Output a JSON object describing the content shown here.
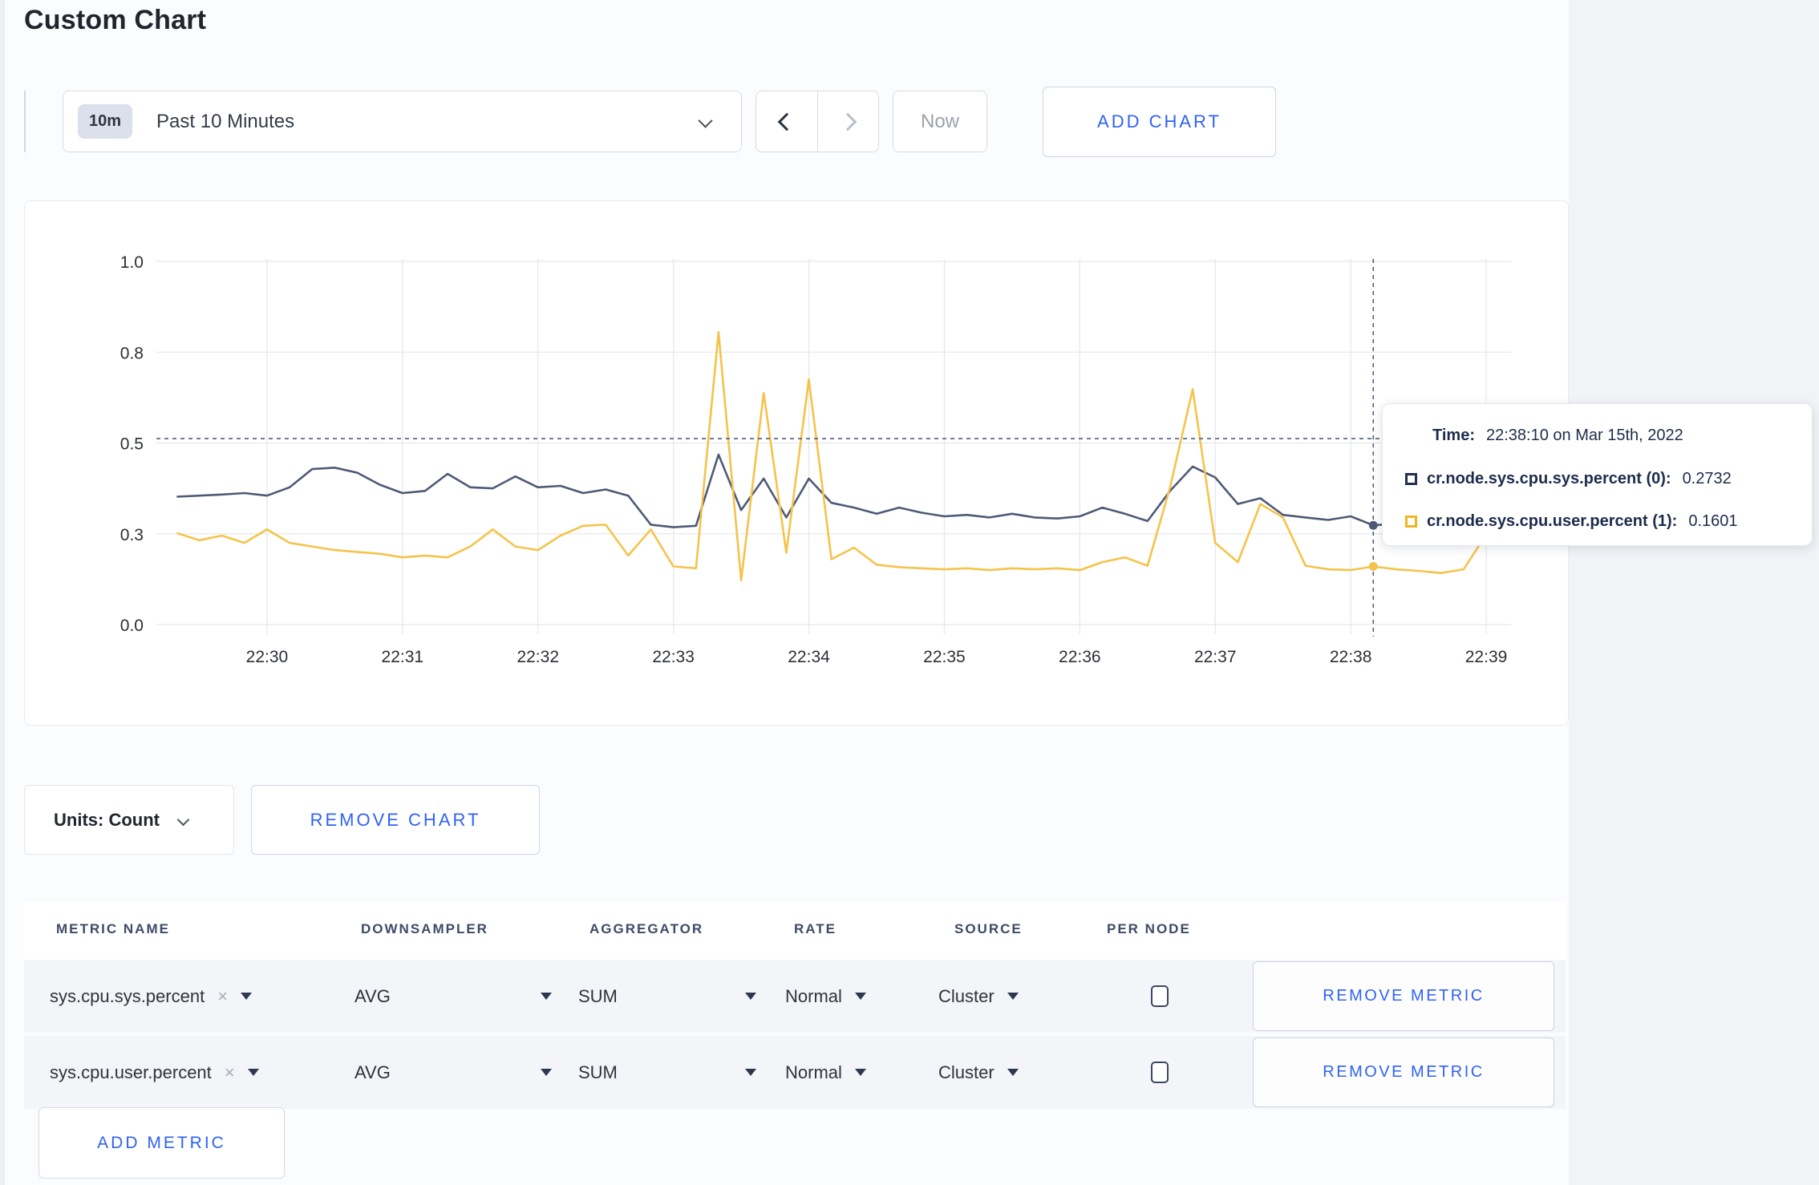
{
  "page": {
    "title": "Custom Chart",
    "background": "#fbfcfd",
    "gutter_color": "#f1f3f7",
    "accent_blue": "#2f62f4"
  },
  "toolbar": {
    "range_badge": "10m",
    "range_label": "Past 10 Minutes",
    "prev_icon": "chevron-left",
    "next_icon": "chevron-right",
    "now_label": "Now",
    "add_chart_label": "ADD CHART"
  },
  "chart_data": {
    "type": "line",
    "title": "",
    "xlabel": "",
    "ylabel": "",
    "ylim": [
      0,
      1
    ],
    "grid": true,
    "legend_position": "none",
    "y_ticks": [
      {
        "label": "1.0",
        "value": 1.0
      },
      {
        "label": "0.8",
        "value": 0.75
      },
      {
        "label": "0.5",
        "value": 0.5
      },
      {
        "label": "0.3",
        "value": 0.25
      },
      {
        "label": "0.0",
        "value": 0.0
      }
    ],
    "x_ticks": [
      "22:30",
      "22:31",
      "22:32",
      "22:33",
      "22:34",
      "22:35",
      "22:36",
      "22:37",
      "22:38",
      "22:39"
    ],
    "x_domain_start": "22:29:11",
    "x_domain_seconds": 600,
    "series_start_time": "22:29:20",
    "series_interval_sec": 10,
    "series": [
      {
        "name": "cr.node.sys.cpu.sys.percent",
        "color": "#4e5b76",
        "values": [
          0.352,
          0.355,
          0.358,
          0.362,
          0.355,
          0.378,
          0.428,
          0.432,
          0.418,
          0.385,
          0.362,
          0.368,
          0.415,
          0.378,
          0.375,
          0.408,
          0.378,
          0.382,
          0.362,
          0.372,
          0.355,
          0.275,
          0.268,
          0.272,
          0.468,
          0.315,
          0.402,
          0.295,
          0.402,
          0.335,
          0.322,
          0.305,
          0.322,
          0.308,
          0.298,
          0.302,
          0.295,
          0.305,
          0.295,
          0.292,
          0.298,
          0.322,
          0.305,
          0.285,
          0.368,
          0.435,
          0.405,
          0.332,
          0.348,
          0.302,
          0.295,
          0.288,
          0.298,
          0.2732,
          0.278,
          0.285,
          0.308,
          0.298,
          0.305,
          0.298
        ]
      },
      {
        "name": "cr.node.sys.cpu.user.percent",
        "color": "#f5c34b",
        "values": [
          0.252,
          0.232,
          0.245,
          0.225,
          0.262,
          0.225,
          0.215,
          0.205,
          0.2,
          0.195,
          0.185,
          0.19,
          0.185,
          0.215,
          0.262,
          0.215,
          0.205,
          0.245,
          0.272,
          0.275,
          0.19,
          0.262,
          0.16,
          0.155,
          0.805,
          0.122,
          0.638,
          0.198,
          0.675,
          0.18,
          0.212,
          0.165,
          0.158,
          0.155,
          0.152,
          0.155,
          0.15,
          0.155,
          0.152,
          0.155,
          0.15,
          0.172,
          0.185,
          0.162,
          0.378,
          0.648,
          0.225,
          0.172,
          0.332,
          0.295,
          0.162,
          0.152,
          0.15,
          0.1601,
          0.152,
          0.148,
          0.142,
          0.152,
          0.248,
          0.222
        ]
      }
    ],
    "crosshair": {
      "time": "22:38:10",
      "h_value": 0.512,
      "color": "#4f5f7d"
    },
    "highlight_points": [
      {
        "series": 0,
        "time": "22:38:10",
        "value": 0.2732
      },
      {
        "series": 1,
        "time": "22:38:10",
        "value": 0.1601
      }
    ],
    "grid_color": "#e6e8ec",
    "tick_color": "#2b2f36"
  },
  "tooltip": {
    "time_label": "Time:",
    "time_value": "22:38:10 on Mar 15th, 2022",
    "rows": [
      {
        "label": "cr.node.sys.cpu.sys.percent (0):",
        "value": "0.2732",
        "color": "#22304f"
      },
      {
        "label": "cr.node.sys.cpu.user.percent (1):",
        "value": "0.1601",
        "color": "#f0b61e"
      }
    ]
  },
  "units_bar": {
    "units_label": "Units: Count",
    "remove_chart_label": "REMOVE CHART"
  },
  "metrics_table": {
    "headers": [
      "METRIC NAME",
      "DOWNSAMPLER",
      "AGGREGATOR",
      "RATE",
      "SOURCE",
      "PER NODE"
    ],
    "rows": [
      {
        "metric": "sys.cpu.sys.percent",
        "downsampler": "AVG",
        "aggregator": "SUM",
        "rate": "Normal",
        "source": "Cluster",
        "per_node_checked": false,
        "remove_label": "REMOVE METRIC"
      },
      {
        "metric": "sys.cpu.user.percent",
        "downsampler": "AVG",
        "aggregator": "SUM",
        "rate": "Normal",
        "source": "Cluster",
        "per_node_checked": false,
        "remove_label": "REMOVE METRIC"
      }
    ],
    "add_metric_label": "ADD METRIC"
  }
}
